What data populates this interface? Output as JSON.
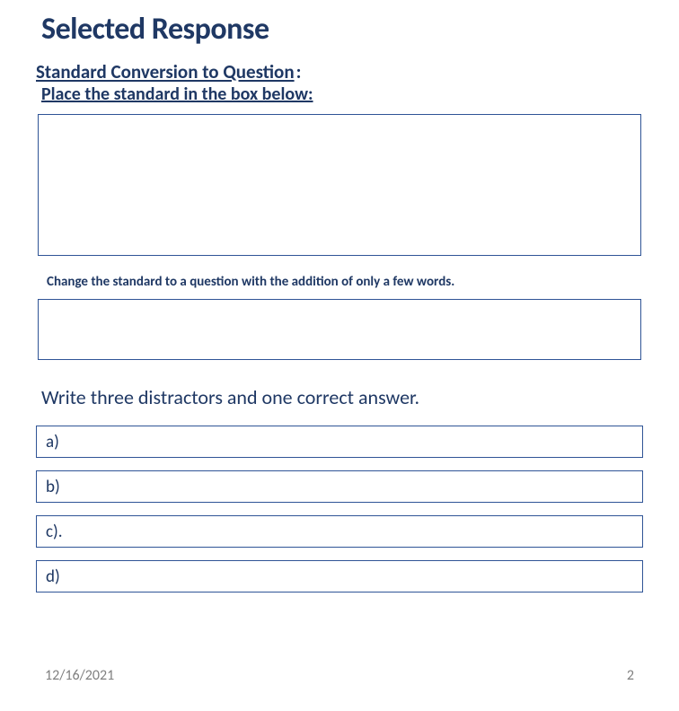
{
  "title": "Selected Response",
  "subtitle": "Standard Conversion to Question",
  "subtitle_suffix": ":",
  "instruction_1": "Place the standard in the box below:",
  "instruction_2": "Change the standard to a question with the addition of only a few words.",
  "instruction_3": "Write three distractors and one correct answer.",
  "answers": {
    "a": "a)",
    "b": "b)",
    "c": "c).",
    "d": "d)"
  },
  "footer": {
    "date": "12/16/2021",
    "page": "2"
  }
}
